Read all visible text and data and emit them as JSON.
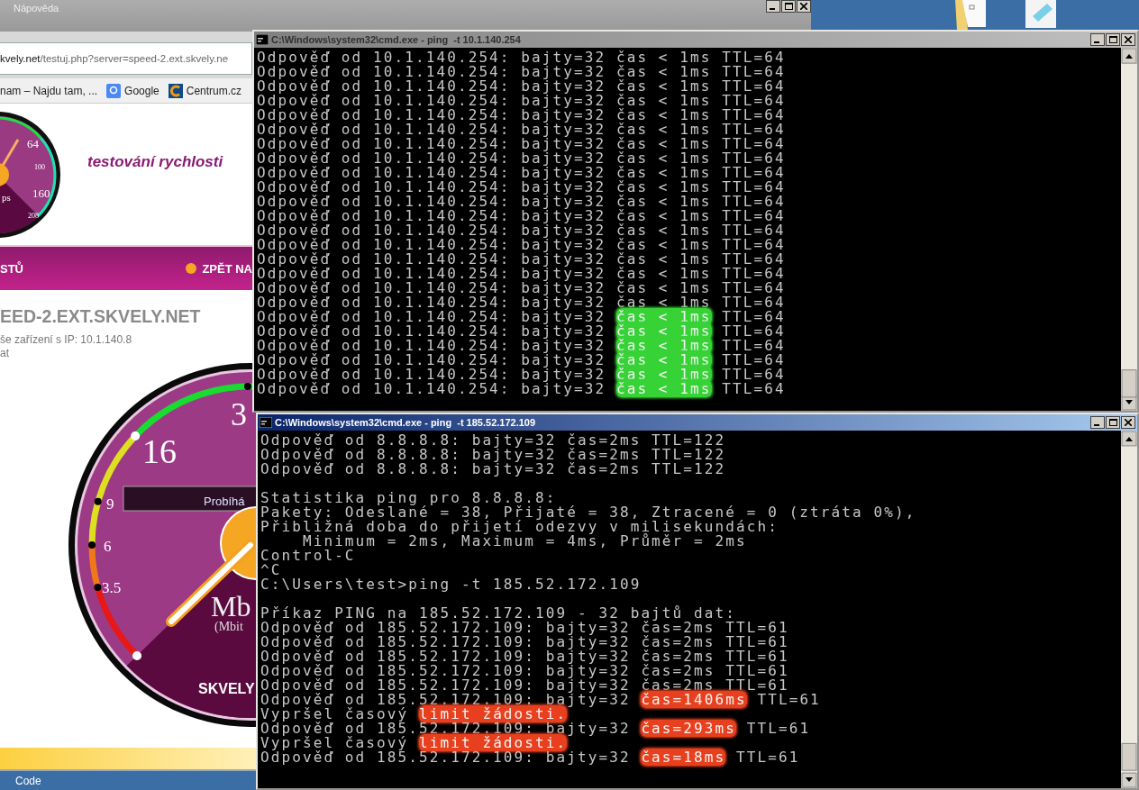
{
  "browser": {
    "menu": [
      "Nápověda"
    ],
    "address": {
      "host": "kvely.net",
      "path": "/testuj.php?server=speed-2.ext.skvely.ne"
    },
    "bookmarks": [
      {
        "label": "nam – Najdu tam, ...",
        "kind": "plain"
      },
      {
        "label": "Google",
        "kind": "google"
      },
      {
        "label": "Centrum.cz",
        "kind": "centrum"
      }
    ],
    "page": {
      "logo_labels": [
        "64",
        "100",
        "160",
        "208",
        "ps"
      ],
      "tagline": "testování rychlosti",
      "nav": [
        {
          "label": "STŮ",
          "kind": "plain"
        },
        {
          "label": "ZPĚT NA",
          "kind": "dot"
        }
      ],
      "server_heading": "EED-2.EXT.SKVELY.NET",
      "info_lines": [
        "še zařízení s IP: 10.1.140.8",
        "at"
      ],
      "gauge": {
        "scale_labels": [
          "3",
          "16",
          "9",
          "6",
          "3.5"
        ],
        "status": "Probíhá",
        "unit": "Mb",
        "unit_note": "(Mbit",
        "brand": "SKVELY"
      }
    }
  },
  "taskbar": {
    "items": [
      "Code"
    ]
  },
  "cmd_windows": [
    {
      "title": "C:\\Windows\\system32\\cmd.exe - ping  -t 10.1.140.254",
      "active": false,
      "lines": [
        {
          "text": "Odpověď od 10.1.140.254: bajty=32 čas < 1ms TTL=64"
        },
        {
          "text": "Odpověď od 10.1.140.254: bajty=32 čas < 1ms TTL=64"
        },
        {
          "text": "Odpověď od 10.1.140.254: bajty=32 čas < 1ms TTL=64"
        },
        {
          "text": "Odpověď od 10.1.140.254: bajty=32 čas < 1ms TTL=64"
        },
        {
          "text": "Odpověď od 10.1.140.254: bajty=32 čas < 1ms TTL=64"
        },
        {
          "text": "Odpověď od 10.1.140.254: bajty=32 čas < 1ms TTL=64"
        },
        {
          "text": "Odpověď od 10.1.140.254: bajty=32 čas < 1ms TTL=64"
        },
        {
          "text": "Odpověď od 10.1.140.254: bajty=32 čas < 1ms TTL=64"
        },
        {
          "text": "Odpověď od 10.1.140.254: bajty=32 čas < 1ms TTL=64"
        },
        {
          "text": "Odpověď od 10.1.140.254: bajty=32 čas < 1ms TTL=64"
        },
        {
          "text": "Odpověď od 10.1.140.254: bajty=32 čas < 1ms TTL=64"
        },
        {
          "text": "Odpověď od 10.1.140.254: bajty=32 čas < 1ms TTL=64"
        },
        {
          "text": "Odpověď od 10.1.140.254: bajty=32 čas < 1ms TTL=64"
        },
        {
          "text": "Odpověď od 10.1.140.254: bajty=32 čas < 1ms TTL=64"
        },
        {
          "text": "Odpověď od 10.1.140.254: bajty=32 čas < 1ms TTL=64"
        },
        {
          "text": "Odpověď od 10.1.140.254: bajty=32 čas < 1ms TTL=64"
        },
        {
          "text": "Odpověď od 10.1.140.254: bajty=32 čas < 1ms TTL=64"
        },
        {
          "text": "Odpověď od 10.1.140.254: bajty=32 čas < 1ms TTL=64"
        },
        {
          "segments": [
            {
              "text": "Odpověď od 10.1.140.254: bajty=32 "
            },
            {
              "text": "čas < 1ms",
              "color": "#36d236"
            },
            {
              "text": " TTL=64"
            }
          ]
        },
        {
          "segments": [
            {
              "text": "Odpověď od 10.1.140.254: bajty=32 "
            },
            {
              "text": "čas < 1ms",
              "color": "#36d236"
            },
            {
              "text": " TTL=64"
            }
          ]
        },
        {
          "segments": [
            {
              "text": "Odpověď od 10.1.140.254: bajty=32 "
            },
            {
              "text": "čas < 1ms",
              "color": "#36d236"
            },
            {
              "text": " TTL=64"
            }
          ]
        },
        {
          "segments": [
            {
              "text": "Odpověď od 10.1.140.254: bajty=32 "
            },
            {
              "text": "čas < 1ms",
              "color": "#36d236"
            },
            {
              "text": " TTL=64"
            }
          ]
        },
        {
          "segments": [
            {
              "text": "Odpověď od 10.1.140.254: bajty=32 "
            },
            {
              "text": "čas < 1ms",
              "color": "#36d236"
            },
            {
              "text": " TTL=64"
            }
          ]
        },
        {
          "segments": [
            {
              "text": "Odpověď od 10.1.140.254: bajty=32 "
            },
            {
              "text": "čas < 1ms",
              "color": "#36d236"
            },
            {
              "text": " TTL=64"
            }
          ]
        }
      ]
    },
    {
      "title": "C:\\Windows\\system32\\cmd.exe - ping  -t 185.52.172.109",
      "active": true,
      "lines": [
        {
          "text": "Odpověď od 8.8.8.8: bajty=32 čas=2ms TTL=122"
        },
        {
          "text": "Odpověď od 8.8.8.8: bajty=32 čas=2ms TTL=122"
        },
        {
          "text": "Odpověď od 8.8.8.8: bajty=32 čas=2ms TTL=122"
        },
        {
          "text": "Statistika ping pro 8.8.8.8:",
          "blank_before": true
        },
        {
          "text": "Pakety: Odeslané = 38, Přijaté = 38, Ztracené = 0 (ztráta 0%),"
        },
        {
          "text": "Přibližná doba do přijetí odezvy v milisekundách:"
        },
        {
          "text": "    Minimum = 2ms, Maximum = 4ms, Průměr = 2ms"
        },
        {
          "text": "Control-C"
        },
        {
          "text": "^C"
        },
        {
          "text": "C:\\Users\\test>ping -t 185.52.172.109"
        },
        {
          "text": "Příkaz PING na 185.52.172.109 - 32 bajtů dat:",
          "blank_before": true
        },
        {
          "text": "Odpověď od 185.52.172.109: bajty=32 čas=2ms TTL=61"
        },
        {
          "text": "Odpověď od 185.52.172.109: bajty=32 čas=2ms TTL=61"
        },
        {
          "text": "Odpověď od 185.52.172.109: bajty=32 čas=2ms TTL=61"
        },
        {
          "text": "Odpověď od 185.52.172.109: bajty=32 čas=2ms TTL=61"
        },
        {
          "text": "Odpověď od 185.52.172.109: bajty=32 čas=2ms TTL=61"
        },
        {
          "segments": [
            {
              "text": "Odpověď od 185.52.172.109: bajty=32 "
            },
            {
              "text": "čas=1406ms",
              "color": "#e8401e"
            },
            {
              "text": " TTL=61"
            }
          ]
        },
        {
          "segments": [
            {
              "text": "Vypršel časový "
            },
            {
              "text": "limit žádosti.",
              "color": "#e8401e"
            }
          ]
        },
        {
          "segments": [
            {
              "text": "Odpověď od 185.52.172.109: bajty=32 "
            },
            {
              "text": "čas=293ms",
              "color": "#e8401e"
            },
            {
              "text": " TTL=61"
            }
          ]
        },
        {
          "segments": [
            {
              "text": "Vypršel časový "
            },
            {
              "text": "limit žádosti.",
              "color": "#e8401e"
            }
          ]
        },
        {
          "segments": [
            {
              "text": "Odpověď od 185.52.172.109: bajty=32 "
            },
            {
              "text": "čas=18ms",
              "color": "#e8401e"
            },
            {
              "text": " TTL=61"
            }
          ]
        }
      ]
    }
  ]
}
